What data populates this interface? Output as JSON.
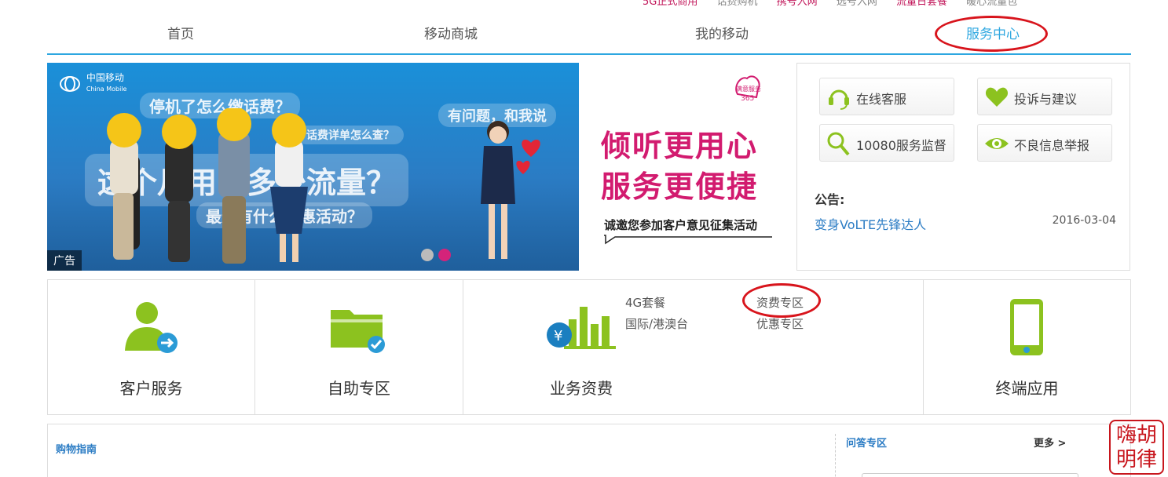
{
  "top_links": [
    {
      "label": "5G正式商用",
      "color": "pink"
    },
    {
      "label": "话费购机",
      "color": "gray"
    },
    {
      "label": "携号入网",
      "color": "pink"
    },
    {
      "label": "选号入网",
      "color": "gray"
    },
    {
      "label": "流量日套餐",
      "color": "pink"
    },
    {
      "label": "暖心流量包",
      "color": "gray"
    }
  ],
  "nav": {
    "items": [
      {
        "label": "首页"
      },
      {
        "label": "移动商城"
      },
      {
        "label": "我的移动"
      },
      {
        "label": "服务中心",
        "active": true
      }
    ],
    "accent_color": "#2ea7e0"
  },
  "banner": {
    "brand_cn": "中国移动",
    "brand_en": "China Mobile",
    "bubbles": [
      "停机了怎么缴话费？",
      "话费详单怎么查？",
      "这个月用了多少流量？",
      "最近有什么优惠活动？",
      "有问题，和我说"
    ],
    "slogan_line1": "倾听更用心",
    "slogan_line2": "服务更便捷",
    "sub_slogan": "诚邀您参加客户意见征集活动",
    "badge": "满意服务365",
    "ad_label": "广告",
    "carousel_dots": 2,
    "carousel_active": 2
  },
  "service_panel": {
    "buttons": [
      {
        "label": "在线客服",
        "icon": "headset-icon"
      },
      {
        "label": "投诉与建议",
        "icon": "heart-icon"
      },
      {
        "label": "10080服务监督",
        "icon": "magnifier-icon"
      },
      {
        "label": "不良信息举报",
        "icon": "eye-icon"
      }
    ],
    "notice_title": "公告:",
    "notice_link": "变身VoLTE先锋达人",
    "notice_date": "2016-03-04"
  },
  "categories": [
    {
      "title": "客户服务",
      "icon": "user-transfer-icon"
    },
    {
      "title": "自助专区",
      "icon": "folder-check-icon"
    },
    {
      "title": "业务资费",
      "icon": "yuan-chart-icon",
      "links": [
        "4G套餐",
        "资费专区",
        "国际/港澳台",
        "优惠专区"
      ]
    },
    {
      "title": "终端应用",
      "icon": "phone-icon"
    }
  ],
  "bottom": {
    "guide_title": "购物指南",
    "qa_title": "问答专区",
    "more_label": "更多 >"
  },
  "seal_text": [
    "胡",
    "明",
    "律",
    "嗨"
  ],
  "colors": {
    "green": "#8cc21f",
    "pink": "#d21b6f",
    "link_blue": "#2b7cc4",
    "annotation_red": "#d8141c"
  }
}
